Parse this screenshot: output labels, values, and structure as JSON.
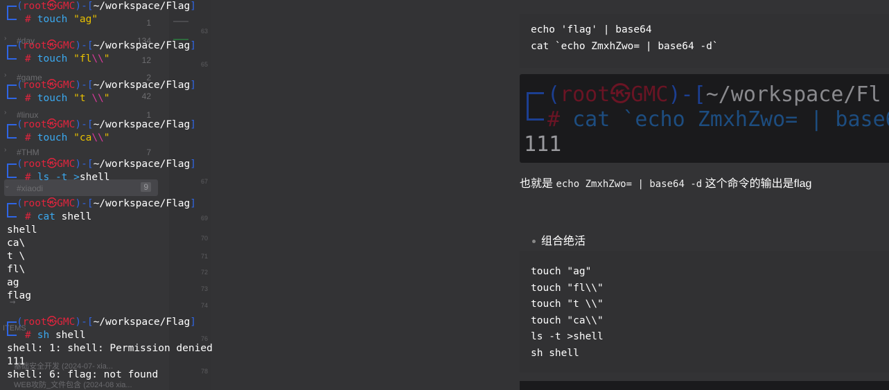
{
  "terminal": {
    "prompt": {
      "user": "root",
      "at": "㉿",
      "host": "GMC",
      "path": "~/workspace/Flag",
      "hash": "#"
    },
    "sessions": [
      {
        "command": "touch",
        "arg": "\"ag\""
      },
      {
        "command": "touch",
        "arg_a": "\"fl",
        "arg_b": "\\\\",
        "arg_c": "\""
      },
      {
        "command": "touch",
        "arg_a": "\"t ",
        "arg_b": "\\\\",
        "arg_c": "\""
      },
      {
        "command": "touch",
        "arg_a": "\"ca",
        "arg_b": "\\\\",
        "arg_c": "\""
      },
      {
        "command": "ls",
        "opt": "-t",
        "redir": ">",
        "arg": "shell"
      },
      {
        "command": "cat",
        "arg": "shell",
        "output": [
          "shell",
          "ca\\",
          "t \\",
          "fl\\",
          "ag",
          "flag"
        ]
      },
      {
        "command": "sh",
        "arg": "shell",
        "output": [
          "shell: 1: shell: Permission denied",
          "111",
          "shell: 6: flag: not found"
        ]
      }
    ]
  },
  "sidebar": {
    "tags": [
      {
        "name": "#day",
        "count": "134"
      },
      {
        "name": "#game",
        "count": "2"
      },
      {
        "name": "#linux",
        "count": "1"
      },
      {
        "name": "#THM",
        "count": "7"
      },
      {
        "name": "#xiaodi",
        "count": "9"
      }
    ],
    "partial_counts": [
      "1",
      "12",
      "42"
    ],
    "items_title": "ITEMS",
    "items": [
      "基础安全开发 (2024-07-  xia...",
      "WEB攻防_文件包含 (2024-08  xia..."
    ]
  },
  "gutter": {
    "line_numbers": [
      "63",
      "65",
      "67",
      "69",
      "70",
      "71",
      "72",
      "73",
      "74",
      "76",
      "78"
    ]
  },
  "document": {
    "code1": [
      "echo 'flag' | base64",
      "cat `echo ZmxhZwo= | base64 -d`"
    ],
    "image": {
      "path_fragment": "~/workspace/Fl",
      "user": "root",
      "host": "GMC",
      "cmd_text": "cat `echo ZmxhZwo= | base6",
      "output": "111"
    },
    "para": {
      "prefix": "也就是 ",
      "code": "echo ZmxhZwo= | base64 -d",
      "suffix": " 这个命令的输出是flag"
    },
    "bullet": "组合绝活",
    "code2": [
      "touch \"ag\"",
      "touch \"fl\\\\\"",
      "touch \"t \\\\\"",
      "touch \"ca\\\\\"",
      "ls -t >shell",
      "sh shell"
    ]
  },
  "colors": {
    "prompt_bracket": "#2f66e5",
    "prompt_user": "#e0243d",
    "command": "#3ba9f0",
    "string": "#e8c000",
    "escape": "#d9399a",
    "background": "#333335"
  }
}
